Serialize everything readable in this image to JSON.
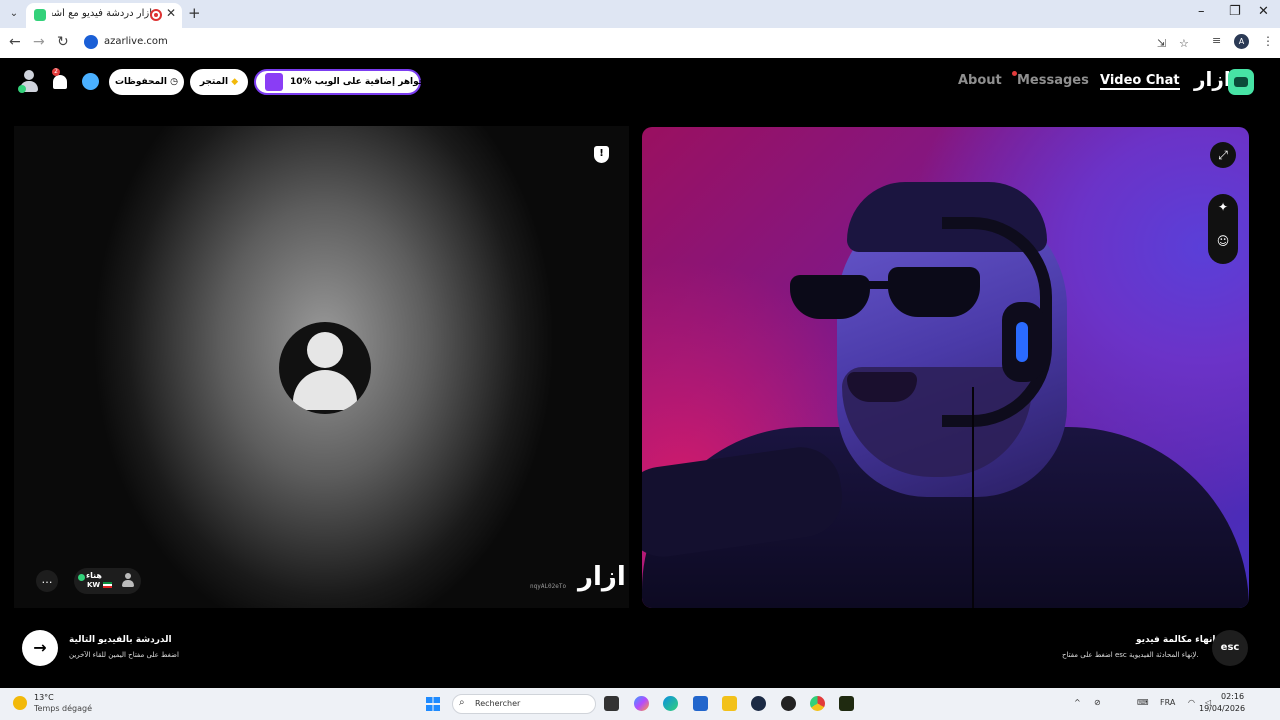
{
  "browser": {
    "tab_title": "أزار دردشة فيديو مع أشخاص",
    "tab_close": "✕",
    "new_tab": "+",
    "url": "azarlive.com",
    "profile_initial": "A"
  },
  "header": {
    "notification_count": "2",
    "saved_label": "المحفوظات",
    "store_label": "المتجر",
    "promo_label": "10% جواهر إضافية على الويب!",
    "nav": {
      "about": "About",
      "messages": "Messages",
      "video_chat": "Video Chat"
    },
    "brand": "ازار"
  },
  "left_panel": {
    "report_icon": "!",
    "user_name": "هناء",
    "user_country": "KW",
    "watermark_id": "nqyAL02eTo",
    "watermark_logo": "ازار"
  },
  "right_panel": {
    "tools": [
      "expand-icon",
      "magic-wand-icon",
      "sticker-icon"
    ]
  },
  "controls": {
    "next_title": "الدردشة بالفيديو التالية",
    "next_hint": "اضغط على مفتاح اليمين للقاء الآخرين",
    "end_title": "إنهاء مكالمة فيديو",
    "end_hint": "اضغط على مفتاح esc لإنهاء المحادثة الفيديوية.",
    "esc_label": "esc"
  },
  "taskbar": {
    "temperature": "13°C",
    "weather": "Temps dégagé",
    "search_placeholder": "Rechercher",
    "language": "FRA",
    "time": "02:16",
    "date": "19/04/2026"
  },
  "colors": {
    "accent_green": "#33d17a",
    "promo_border": "#7b3cf0",
    "badge_red": "#e23b3b"
  }
}
